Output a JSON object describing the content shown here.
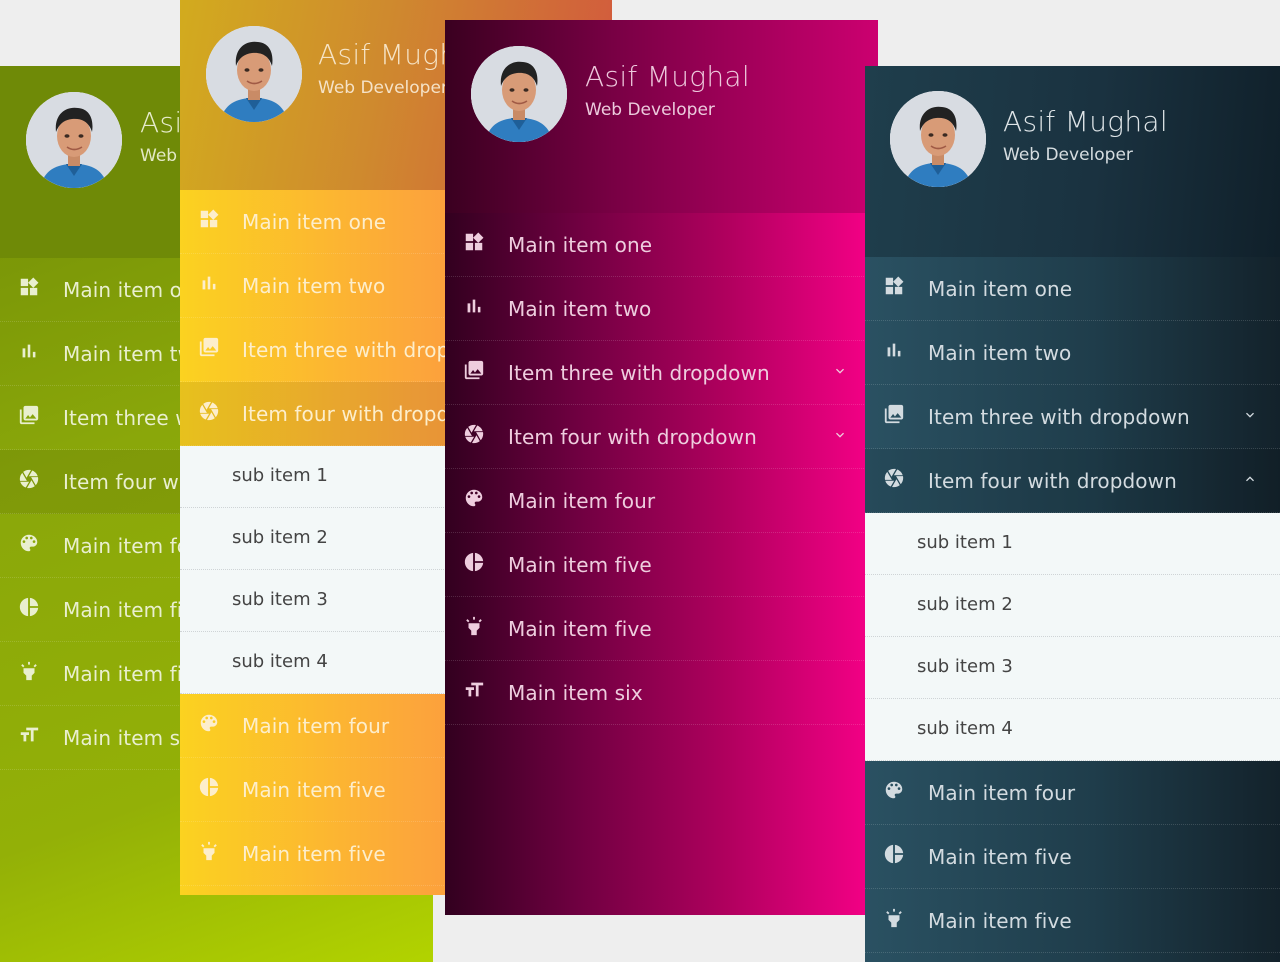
{
  "colors": {
    "page_background": "#eeeeee",
    "green_theme": "#8aa70a",
    "orange_theme": "#fca63b",
    "magenta_theme": "#b0005e",
    "teal_theme": "#1f3d4b",
    "submenu_background": "#f3f8f8"
  },
  "profile": {
    "name": "Asif Mughal",
    "role": "Web Developer",
    "avatar_icon": "user-photo"
  },
  "menus": {
    "green": {
      "theme": "green",
      "items": [
        {
          "label": "Main item one",
          "icon": "widgets-icon"
        },
        {
          "label": "Main item two",
          "icon": "bar-chart-icon"
        },
        {
          "label": "Item three with dropdown",
          "icon": "photo-library-icon"
        },
        {
          "label": "Item four with dropdown",
          "icon": "camera-shutter-icon",
          "active": true
        },
        {
          "label": "Main item four",
          "icon": "palette-icon"
        },
        {
          "label": "Main item five",
          "icon": "pie-chart-icon"
        },
        {
          "label": "Main item five",
          "icon": "flashlight-icon"
        },
        {
          "label": "Main item six",
          "icon": "text-size-icon"
        }
      ]
    },
    "orange": {
      "theme": "orange",
      "items": [
        {
          "label": "Main item one",
          "icon": "widgets-icon"
        },
        {
          "label": "Main item two",
          "icon": "bar-chart-icon"
        },
        {
          "label": "Item three with dropdown",
          "icon": "photo-library-icon"
        },
        {
          "label": "Item four with dropdown",
          "icon": "camera-shutter-icon",
          "active": true,
          "expanded": true
        },
        {
          "label": "Main item four",
          "icon": "palette-icon"
        },
        {
          "label": "Main item five",
          "icon": "pie-chart-icon"
        },
        {
          "label": "Main item five",
          "icon": "flashlight-icon"
        }
      ],
      "sub_items": [
        "sub item 1",
        "sub item 2",
        "sub item 3",
        "sub item 4"
      ]
    },
    "magenta": {
      "theme": "magenta",
      "items": [
        {
          "label": "Main item one",
          "icon": "widgets-icon"
        },
        {
          "label": "Main item two",
          "icon": "bar-chart-icon"
        },
        {
          "label": "Item three with dropdown",
          "icon": "photo-library-icon",
          "chevron": "chevron-down-icon"
        },
        {
          "label": "Item four with dropdown",
          "icon": "camera-shutter-icon",
          "chevron": "chevron-down-icon"
        },
        {
          "label": "Main item four",
          "icon": "palette-icon"
        },
        {
          "label": "Main item five",
          "icon": "pie-chart-icon"
        },
        {
          "label": "Main item five",
          "icon": "flashlight-icon"
        },
        {
          "label": "Main item six",
          "icon": "text-size-icon"
        }
      ]
    },
    "teal": {
      "theme": "teal",
      "items": [
        {
          "label": "Main item one",
          "icon": "widgets-icon"
        },
        {
          "label": "Main item two",
          "icon": "bar-chart-icon"
        },
        {
          "label": "Item three with dropdown",
          "icon": "photo-library-icon",
          "chevron": "chevron-down-icon"
        },
        {
          "label": "Item four with dropdown",
          "icon": "camera-shutter-icon",
          "chevron": "chevron-up-icon",
          "active": true,
          "expanded": true
        },
        {
          "label": "Main item four",
          "icon": "palette-icon"
        },
        {
          "label": "Main item five",
          "icon": "pie-chart-icon"
        },
        {
          "label": "Main item five",
          "icon": "flashlight-icon"
        }
      ],
      "sub_items": [
        "sub item 1",
        "sub item 2",
        "sub item 3",
        "sub item 4"
      ]
    }
  }
}
